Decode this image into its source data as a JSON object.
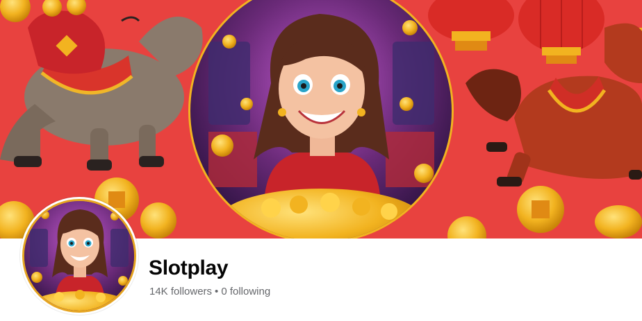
{
  "page": {
    "name": "Slotplay",
    "followers": "14K followers",
    "separator": "•",
    "following": "0 following"
  },
  "colors": {
    "cover_background": "#e8423f",
    "gold": "#e6a420",
    "name_text": "#050505",
    "secondary_text": "#65676b"
  },
  "icons": {
    "cover": [
      "donkey-illustration",
      "lantern-icon",
      "horse-illustration",
      "gold-coin-icon",
      "character-portrait"
    ],
    "avatar": [
      "character-portrait"
    ]
  }
}
